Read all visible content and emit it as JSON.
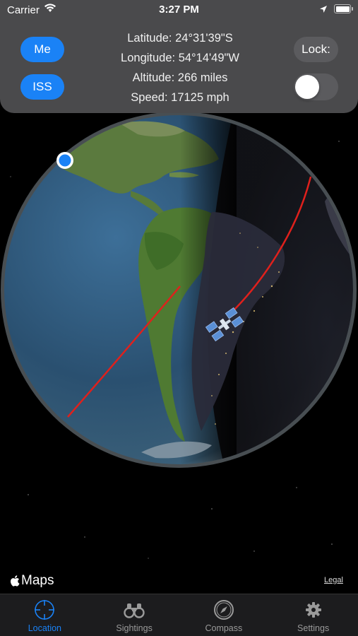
{
  "status": {
    "carrier": "Carrier",
    "time": "3:27 PM"
  },
  "panel": {
    "me_label": "Me",
    "iss_label": "ISS",
    "latitude": "Latitude: 24°31'39\"S",
    "longitude": "Longitude: 54°14'49\"W",
    "altitude": "Altitude: 266 miles",
    "speed": "Speed: 17125 mph",
    "lock_label": "Lock:",
    "lock_on": false
  },
  "map": {
    "attribution": "Maps",
    "legal": "Legal",
    "orbit_color": "#e0201c",
    "marker_color": "#1a82f6"
  },
  "tabs": [
    {
      "label": "Location",
      "icon": "crosshair-icon",
      "active": true
    },
    {
      "label": "Sightings",
      "icon": "binoculars-icon",
      "active": false
    },
    {
      "label": "Compass",
      "icon": "compass-icon",
      "active": false
    },
    {
      "label": "Settings",
      "icon": "gear-icon",
      "active": false
    }
  ],
  "colors": {
    "accent": "#1a82f6",
    "panel_bg": "#4a4a4c",
    "tab_inactive": "#9a9a9a"
  }
}
